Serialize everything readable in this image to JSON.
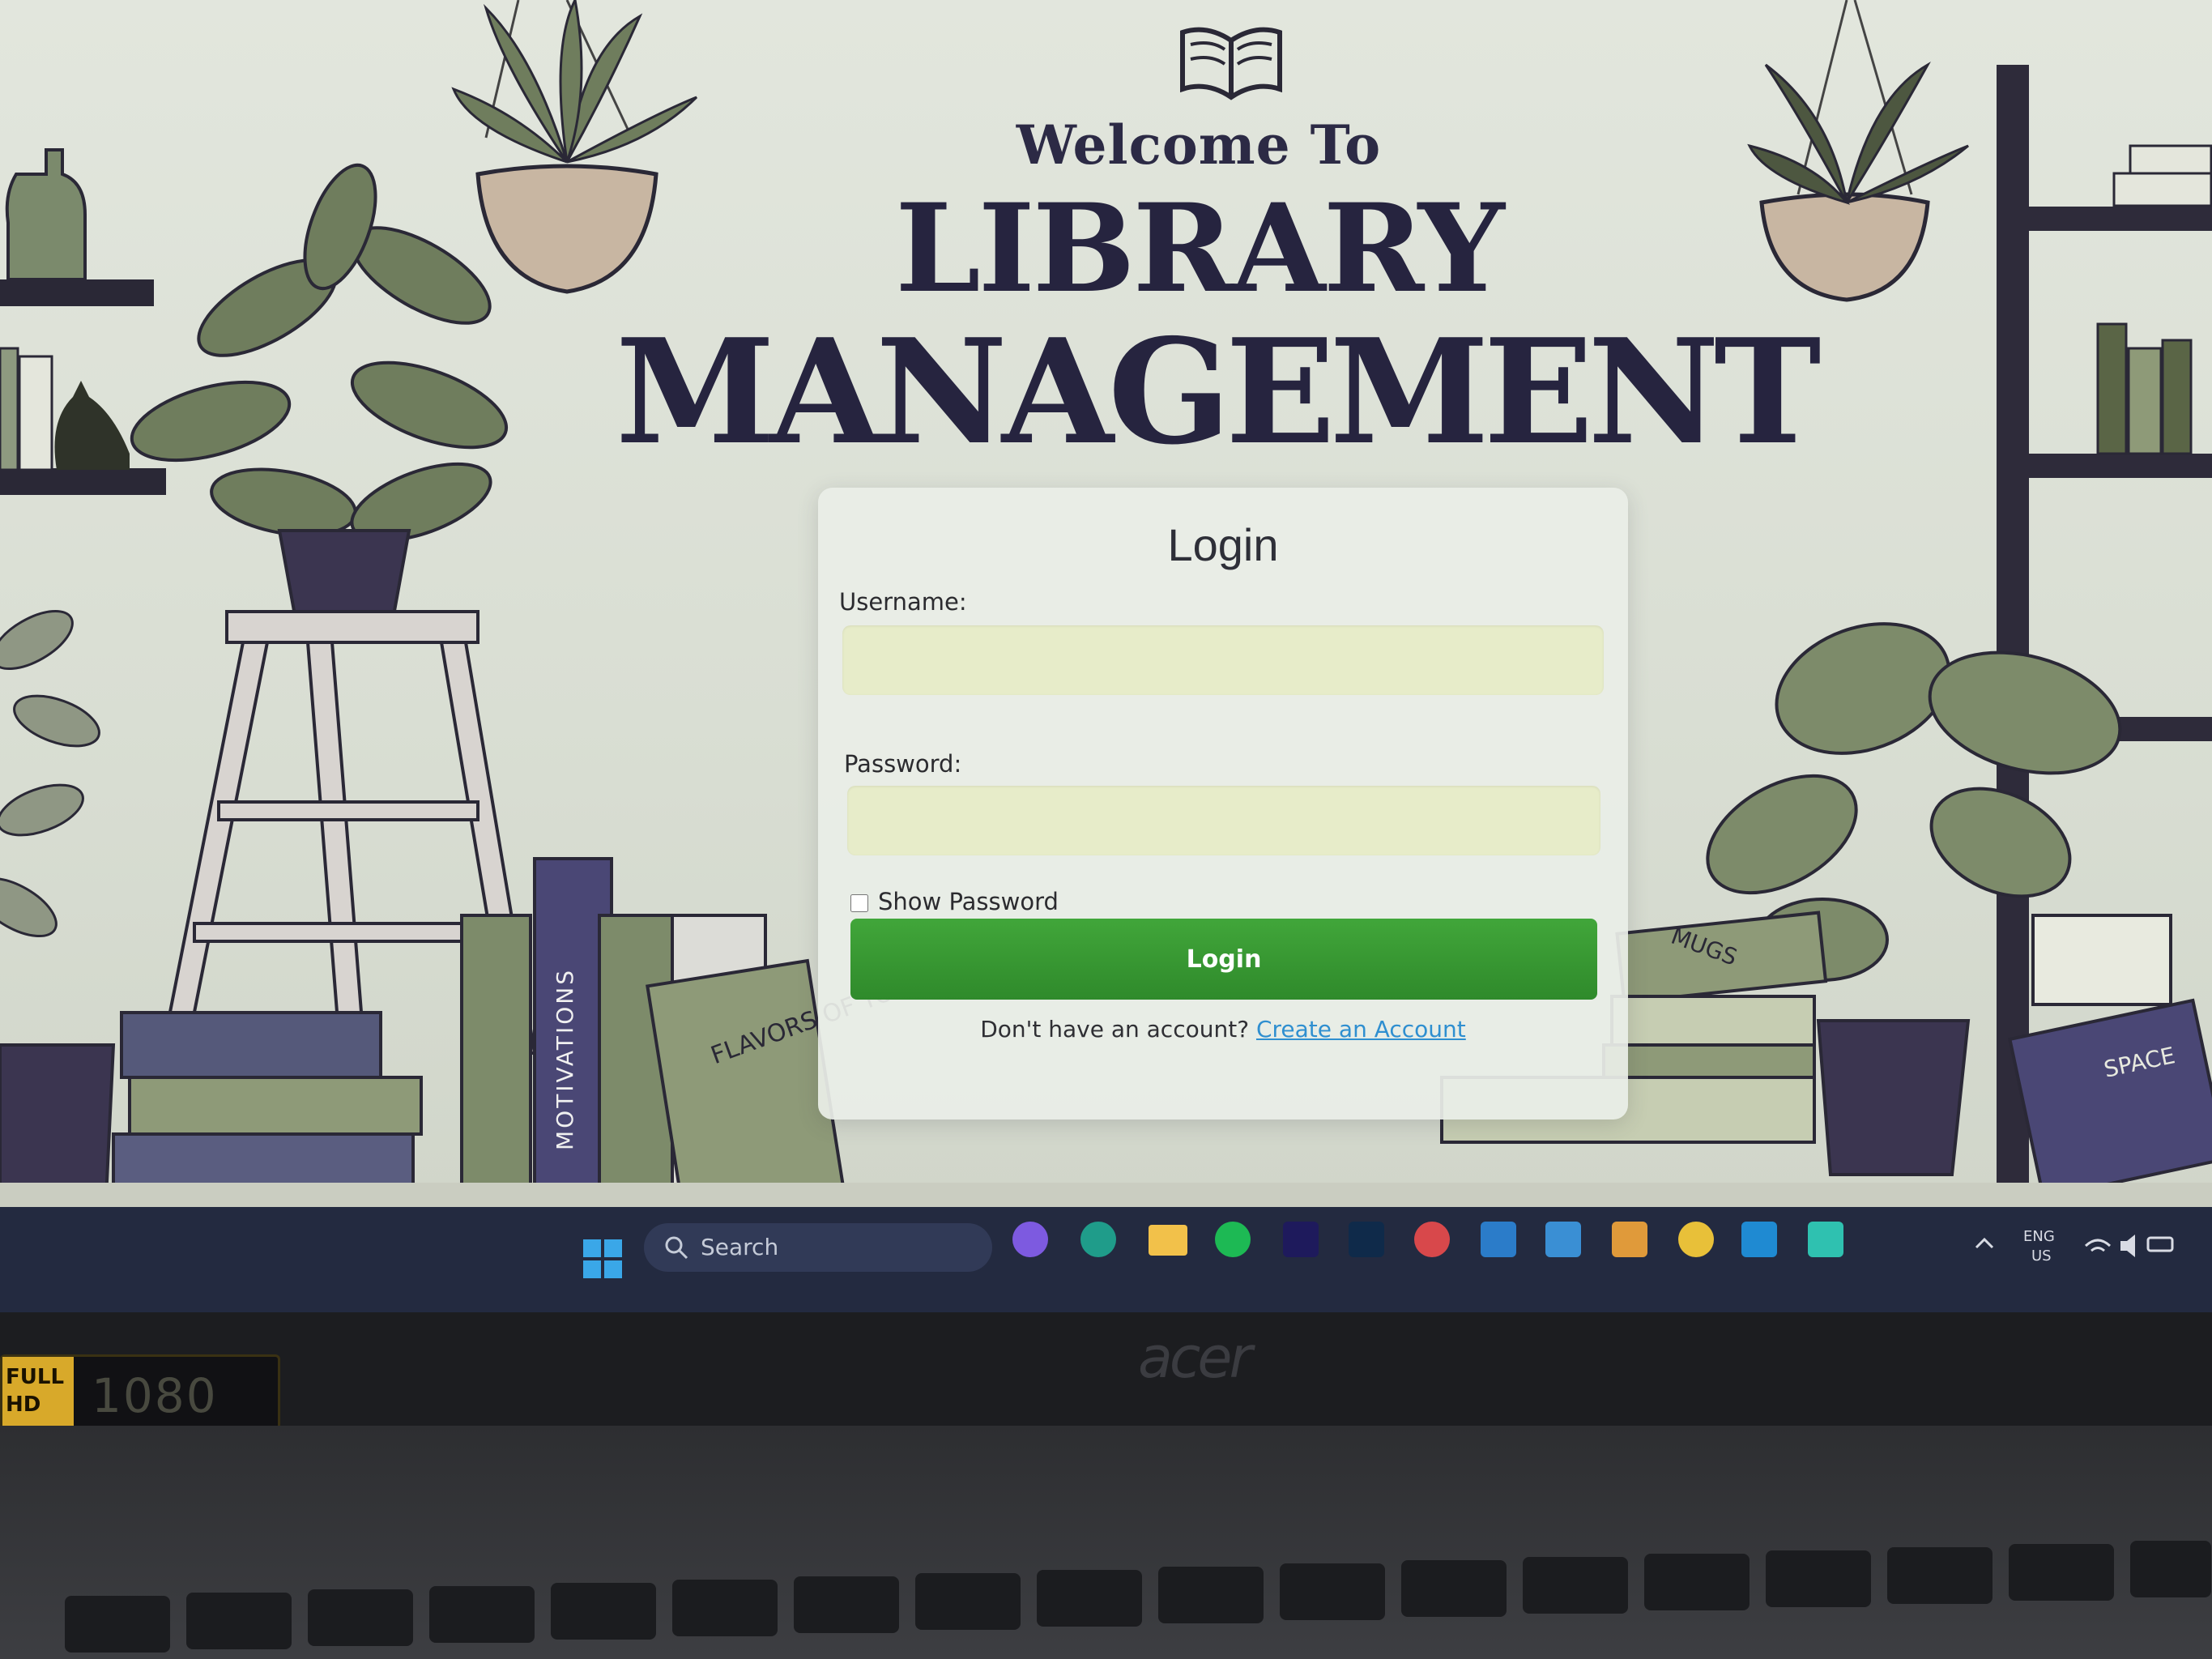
{
  "header": {
    "welcome": "Welcome To",
    "title_line1": "LIBRARY",
    "title_line2": "MANAGEMENT"
  },
  "login": {
    "heading": "Login",
    "username_label": "Username:",
    "username_value": "",
    "password_label": "Password:",
    "password_value": "",
    "show_password_label": "Show Password",
    "show_password_checked": false,
    "submit_label": "Login",
    "signup_prompt": "Don't have an account?",
    "signup_link": "Create an Account"
  },
  "illustration": {
    "book_spine_1": "MOTIVATIONS",
    "book_cover": "FLAVORS OF YOGURT",
    "box_label": "MUGS",
    "book_right": "SPACE"
  },
  "taskbar": {
    "search_placeholder": "Search",
    "apps": [
      "start-icon",
      "copilot-icon",
      "edge-icon",
      "file-explorer-icon",
      "spotify-icon",
      "premiere-pro-icon",
      "photoshop-icon",
      "pinterest-icon",
      "app-icon",
      "snipping-tool-icon",
      "app-icon",
      "chrome-icon",
      "vscode-icon",
      "notepad-icon"
    ],
    "tray_lang": "ENG",
    "tray_region": "US"
  },
  "laptop": {
    "brand": "acer",
    "sticker_badge": "FULL HD",
    "sticker_resolution": "1080"
  },
  "colors": {
    "title": "#26243f",
    "login_button": "#359a31",
    "link": "#2f8fd0",
    "input_bg": "#e7ecc9",
    "taskbar": "#232a40"
  }
}
